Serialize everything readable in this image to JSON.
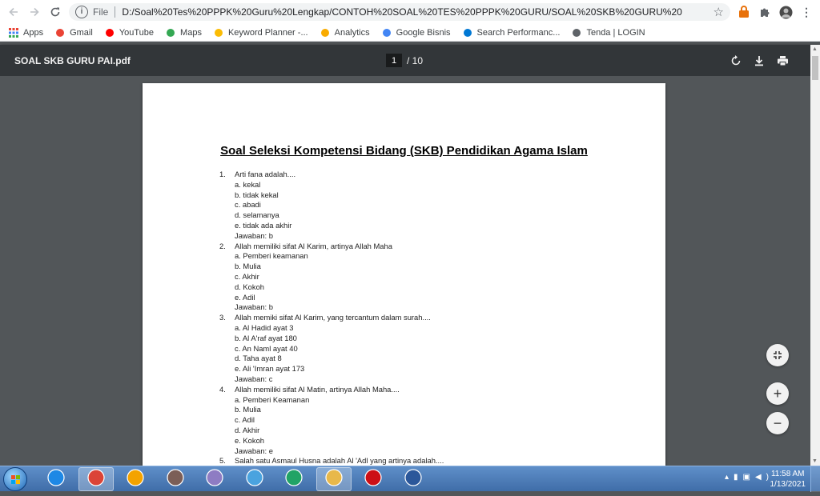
{
  "browser": {
    "file_label": "File",
    "url": "D:/Soal%20Tes%20PPPK%20Guru%20Lengkap/CONTOH%20SOAL%20TES%20PPPK%20GURU/SOAL%20SKB%20GURU%20PAI.pdf",
    "bookmarks": [
      {
        "label": "Apps",
        "icon": "apps-grid-icon",
        "color": "#ea4335"
      },
      {
        "label": "Gmail",
        "icon": "gmail-icon",
        "color": "#ea4335"
      },
      {
        "label": "YouTube",
        "icon": "youtube-icon",
        "color": "#ff0000"
      },
      {
        "label": "Maps",
        "icon": "maps-pin-icon",
        "color": "#34a853"
      },
      {
        "label": "Keyword Planner -...",
        "icon": "google-ads-icon",
        "color": "#fbbc04"
      },
      {
        "label": "Analytics",
        "icon": "analytics-icon",
        "color": "#f9ab00"
      },
      {
        "label": "Google Bisnis",
        "icon": "google-business-icon",
        "color": "#4285f4"
      },
      {
        "label": "Search Performanc...",
        "icon": "bing-icon",
        "color": "#0078d4"
      },
      {
        "label": "Tenda | LOGIN",
        "icon": "globe-icon",
        "color": "#5f6368"
      }
    ]
  },
  "viewer": {
    "title": "SOAL SKB GURU PAI.pdf",
    "page_current": "1",
    "page_total": "/ 10"
  },
  "document": {
    "heading": "Soal Seleksi Kompetensi Bidang (SKB) Pendidikan Agama Islam",
    "questions": [
      {
        "number": "1.",
        "text": "Arti fana adalah....",
        "options": [
          "a. kekal",
          "b. tidak kekal",
          "c. abadi",
          "d. selamanya",
          "e. tidak ada akhir"
        ],
        "answer": "Jawaban: b"
      },
      {
        "number": "2.",
        "text": "Allah memiliki sifat Al Karim, artinya Allah Maha",
        "options": [
          "a. Pemberi keamanan",
          "b. Mulia",
          "c. Akhir",
          "d. Kokoh",
          "e. Adil"
        ],
        "answer": "Jawaban: b"
      },
      {
        "number": "3.",
        "text": " Allah memiki sifat Al Karim, yang tercantum dalam surah....",
        "options": [
          "a. Al Hadid ayat 3",
          "b. Al A'raf ayat 180",
          "c. An Naml ayat 40",
          "d. Taha ayat 8",
          "e.  Ali 'Imran ayat 173"
        ],
        "answer": "Jawaban: c"
      },
      {
        "number": "4.",
        "text": "Allah memiliki sifat Al Matin, artinya Allah Maha....",
        "options": [
          "a. Pemberi Keamanan",
          "b. Mulia",
          "c. Adil",
          "d. Akhir",
          "e. Kokoh"
        ],
        "answer": "Jawaban: e"
      },
      {
        "number": "5.",
        "text": "Salah satu Asmaul Husna adalah Al 'Adl yang artinya adalah....",
        "options": [],
        "answer": ""
      }
    ]
  },
  "taskbar": {
    "clock_time": "11:58 AM",
    "clock_date": "1/13/2021",
    "apps": [
      "internet-explorer-icon",
      "chrome-icon",
      "media-player-icon",
      "movie-maker-icon",
      "paint-icon",
      "notes-icon",
      "excel-icon",
      "file-explorer-icon",
      "opera-icon",
      "word-icon"
    ]
  }
}
